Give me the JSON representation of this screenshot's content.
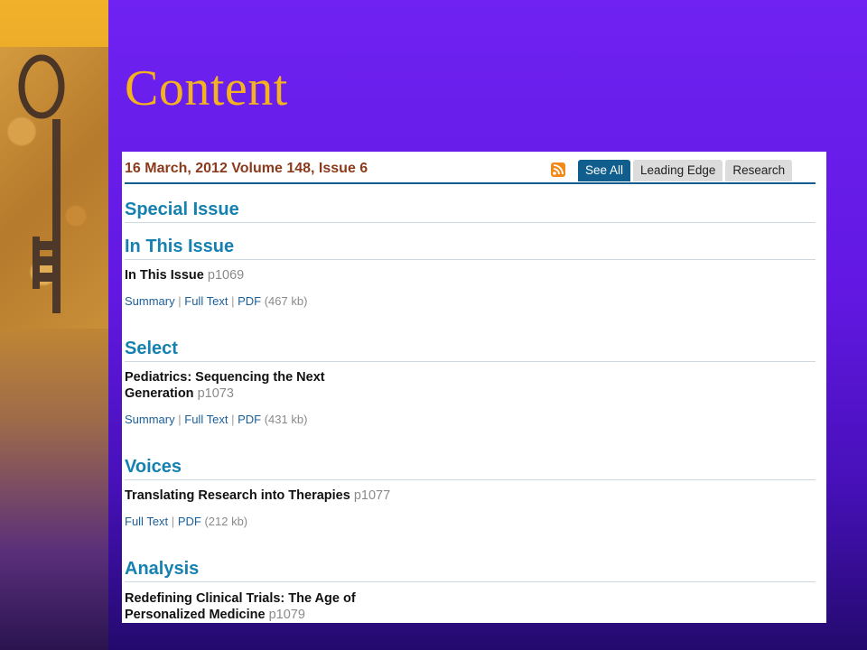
{
  "slide": {
    "title": "Content"
  },
  "page": {
    "issue_title": "16 March, 2012 Volume 148, Issue 6",
    "tabs": [
      {
        "label": "See All",
        "active": true
      },
      {
        "label": "Leading Edge",
        "active": false
      },
      {
        "label": "Research",
        "active": false
      }
    ],
    "sections": {
      "special": {
        "heading": "Special Issue"
      },
      "in_this_issue": {
        "heading": "In This Issue",
        "article": {
          "title": "In This Issue",
          "page": "p1069",
          "summary": "Summary",
          "full_text": "Full Text",
          "pdf": "PDF",
          "pdf_size": "(467 kb)"
        }
      },
      "select": {
        "heading": "Select",
        "article": {
          "title_line1": "Pediatrics: Sequencing the Next",
          "title_line2": "Generation",
          "page": "p1073",
          "summary": "Summary",
          "full_text": "Full Text",
          "pdf": "PDF",
          "pdf_size": "(431 kb)"
        }
      },
      "voices": {
        "heading": "Voices",
        "article": {
          "title": "Translating Research into Therapies",
          "page": "p1077",
          "full_text": "Full Text",
          "pdf": "PDF",
          "pdf_size": "(212 kb)"
        }
      },
      "analysis": {
        "heading": "Analysis",
        "article": {
          "title_line1": "Redefining Clinical Trials: The Age of",
          "title_line2": "Personalized Medicine",
          "page": "p1079"
        }
      }
    },
    "separator": "|"
  },
  "icons": {
    "rss": "rss-feed-icon",
    "key": "skeleton-key-image"
  },
  "colors": {
    "title_gold": "#f5b21f",
    "slide_purple": "#6a1fe0",
    "link_blue": "#1b5f9a",
    "heading_blue": "#1581b0",
    "issue_brown": "#8b3a1c",
    "tab_active": "#0f5e8e"
  }
}
